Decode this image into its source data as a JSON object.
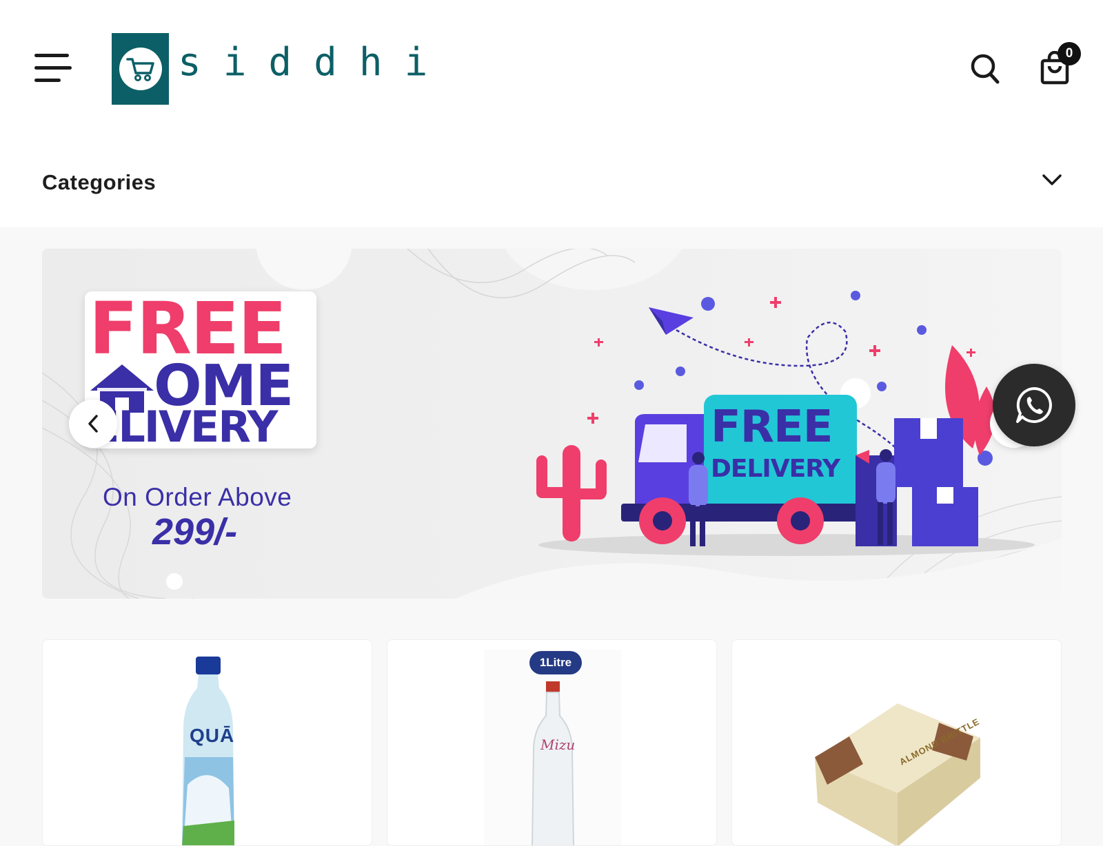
{
  "header": {
    "brand_name": "siddhi",
    "cart_count": "0"
  },
  "categories": {
    "label": "Categories"
  },
  "banner": {
    "headline_free": "FREE",
    "headline_home": "OME",
    "headline_delivery": "ELIVERY",
    "order_text": "On Order Above",
    "order_amount": "299/-",
    "truck_free": "FREE",
    "truck_delivery": "DELIVERY",
    "active_slide": 1
  },
  "products": [
    {
      "label": "QUĀ"
    },
    {
      "tag": "1Litre",
      "label": "Mizu"
    },
    {
      "label": "ALMOND BRITTLE"
    }
  ],
  "colors": {
    "brand_teal": "#0c5f66",
    "banner_pink": "#ef3e6b",
    "banner_purple": "#3a2fa7",
    "truck_cyan": "#22c7d6"
  }
}
